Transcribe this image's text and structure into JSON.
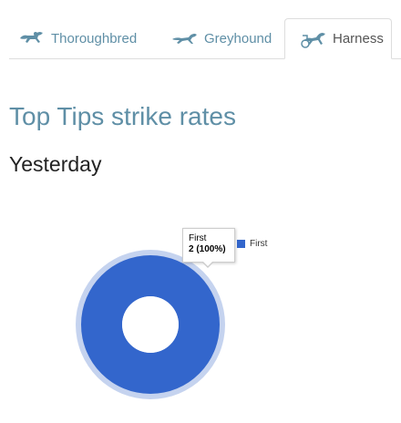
{
  "tabs": [
    {
      "label": "Thoroughbred",
      "icon": "thoroughbred-horse-icon",
      "active": false
    },
    {
      "label": "Greyhound",
      "icon": "greyhound-icon",
      "active": false
    },
    {
      "label": "Harness",
      "icon": "harness-horse-icon",
      "active": true
    }
  ],
  "page": {
    "title": "Top Tips strike rates",
    "subtitle": "Yesterday"
  },
  "colors": {
    "accent": "#5f8fa6",
    "slice": "#3366cc",
    "halo": "#c5d3ef"
  },
  "chart_data": {
    "type": "pie",
    "categories": [
      "First"
    ],
    "values": [
      2
    ],
    "labels": [
      "2 (100%)"
    ],
    "donut": true,
    "legend": "right"
  },
  "tooltip": {
    "label": "First",
    "value": "2 (100%)"
  }
}
